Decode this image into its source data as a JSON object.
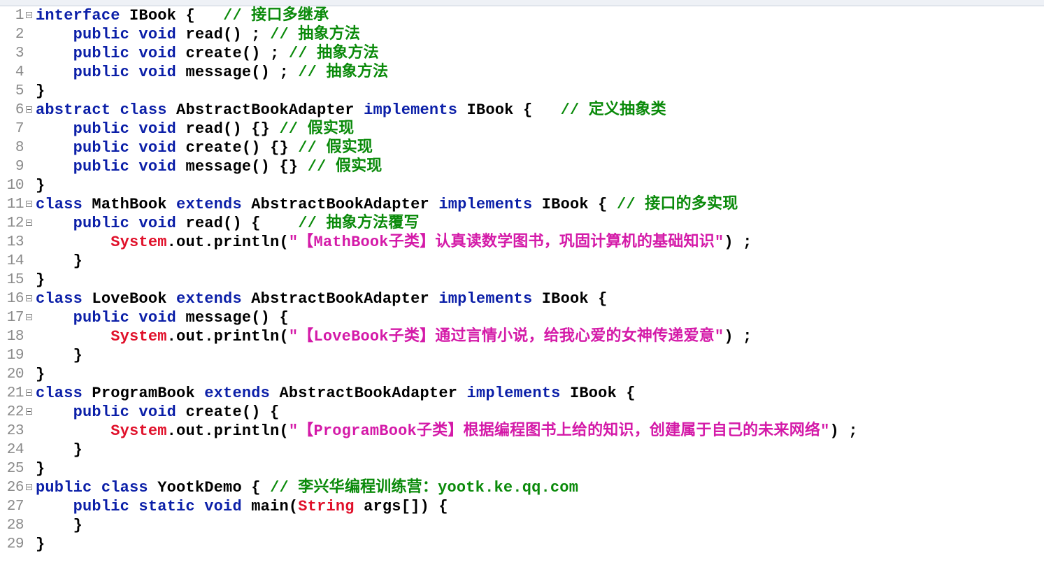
{
  "lines": [
    {
      "num": "1",
      "fold": true,
      "segs": [
        [
          "kw",
          "interface"
        ],
        [
          "pl",
          " IBook {   "
        ],
        [
          "cm",
          "// 接口多继承"
        ]
      ]
    },
    {
      "num": "2",
      "fold": false,
      "segs": [
        [
          "pl",
          "    "
        ],
        [
          "kw",
          "public void"
        ],
        [
          "pl",
          " read() ; "
        ],
        [
          "cm",
          "// 抽象方法"
        ]
      ]
    },
    {
      "num": "3",
      "fold": false,
      "segs": [
        [
          "pl",
          "    "
        ],
        [
          "kw",
          "public void"
        ],
        [
          "pl",
          " create() ; "
        ],
        [
          "cm",
          "// 抽象方法"
        ]
      ]
    },
    {
      "num": "4",
      "fold": false,
      "segs": [
        [
          "pl",
          "    "
        ],
        [
          "kw",
          "public void"
        ],
        [
          "pl",
          " message() ; "
        ],
        [
          "cm",
          "// 抽象方法"
        ]
      ]
    },
    {
      "num": "5",
      "fold": false,
      "segs": [
        [
          "pl",
          "}"
        ]
      ]
    },
    {
      "num": "6",
      "fold": true,
      "segs": [
        [
          "kw",
          "abstract class"
        ],
        [
          "pl",
          " AbstractBookAdapter "
        ],
        [
          "kw",
          "implements"
        ],
        [
          "pl",
          " IBook {   "
        ],
        [
          "cm",
          "// 定义抽象类"
        ]
      ]
    },
    {
      "num": "7",
      "fold": false,
      "segs": [
        [
          "pl",
          "    "
        ],
        [
          "kw",
          "public void"
        ],
        [
          "pl",
          " read() {} "
        ],
        [
          "cm",
          "// 假实现"
        ]
      ]
    },
    {
      "num": "8",
      "fold": false,
      "segs": [
        [
          "pl",
          "    "
        ],
        [
          "kw",
          "public void"
        ],
        [
          "pl",
          " create() {} "
        ],
        [
          "cm",
          "// 假实现"
        ]
      ]
    },
    {
      "num": "9",
      "fold": false,
      "segs": [
        [
          "pl",
          "    "
        ],
        [
          "kw",
          "public void"
        ],
        [
          "pl",
          " message() {} "
        ],
        [
          "cm",
          "// 假实现"
        ]
      ]
    },
    {
      "num": "10",
      "fold": false,
      "segs": [
        [
          "pl",
          "}"
        ]
      ]
    },
    {
      "num": "11",
      "fold": true,
      "segs": [
        [
          "kw",
          "class"
        ],
        [
          "pl",
          " MathBook "
        ],
        [
          "kw",
          "extends"
        ],
        [
          "pl",
          " AbstractBookAdapter "
        ],
        [
          "kw",
          "implements"
        ],
        [
          "pl",
          " IBook { "
        ],
        [
          "cm",
          "// 接口的多实现"
        ]
      ]
    },
    {
      "num": "12",
      "fold": true,
      "segs": [
        [
          "pl",
          "    "
        ],
        [
          "kw",
          "public void"
        ],
        [
          "pl",
          " read() {    "
        ],
        [
          "cm",
          "// 抽象方法覆写"
        ]
      ]
    },
    {
      "num": "13",
      "fold": false,
      "segs": [
        [
          "pl",
          "        "
        ],
        [
          "cls",
          "System"
        ],
        [
          "pl",
          ".out.println("
        ],
        [
          "str",
          "\"【MathBook子类】认真读数学图书，巩固计算机的基础知识\""
        ],
        [
          "pl",
          ") ;"
        ]
      ]
    },
    {
      "num": "14",
      "fold": false,
      "segs": [
        [
          "pl",
          "    }"
        ]
      ]
    },
    {
      "num": "15",
      "fold": false,
      "segs": [
        [
          "pl",
          "}"
        ]
      ]
    },
    {
      "num": "16",
      "fold": true,
      "segs": [
        [
          "kw",
          "class"
        ],
        [
          "pl",
          " LoveBook "
        ],
        [
          "kw",
          "extends"
        ],
        [
          "pl",
          " AbstractBookAdapter "
        ],
        [
          "kw",
          "implements"
        ],
        [
          "pl",
          " IBook {"
        ]
      ]
    },
    {
      "num": "17",
      "fold": true,
      "segs": [
        [
          "pl",
          "    "
        ],
        [
          "kw",
          "public void"
        ],
        [
          "pl",
          " message() {"
        ]
      ]
    },
    {
      "num": "18",
      "fold": false,
      "segs": [
        [
          "pl",
          "        "
        ],
        [
          "cls",
          "System"
        ],
        [
          "pl",
          ".out.println("
        ],
        [
          "str",
          "\"【LoveBook子类】通过言情小说，给我心爱的女神传递爱意\""
        ],
        [
          "pl",
          ") ;"
        ]
      ]
    },
    {
      "num": "19",
      "fold": false,
      "segs": [
        [
          "pl",
          "    }"
        ]
      ]
    },
    {
      "num": "20",
      "fold": false,
      "segs": [
        [
          "pl",
          "}"
        ]
      ]
    },
    {
      "num": "21",
      "fold": true,
      "segs": [
        [
          "kw",
          "class"
        ],
        [
          "pl",
          " ProgramBook "
        ],
        [
          "kw",
          "extends"
        ],
        [
          "pl",
          " AbstractBookAdapter "
        ],
        [
          "kw",
          "implements"
        ],
        [
          "pl",
          " IBook {"
        ]
      ]
    },
    {
      "num": "22",
      "fold": true,
      "segs": [
        [
          "pl",
          "    "
        ],
        [
          "kw",
          "public void"
        ],
        [
          "pl",
          " create() {"
        ]
      ]
    },
    {
      "num": "23",
      "fold": false,
      "segs": [
        [
          "pl",
          "        "
        ],
        [
          "cls",
          "System"
        ],
        [
          "pl",
          ".out.println("
        ],
        [
          "str",
          "\"【ProgramBook子类】根据编程图书上给的知识，创建属于自己的未来网络\""
        ],
        [
          "pl",
          ") ;"
        ]
      ]
    },
    {
      "num": "24",
      "fold": false,
      "segs": [
        [
          "pl",
          "    }"
        ]
      ]
    },
    {
      "num": "25",
      "fold": false,
      "segs": [
        [
          "pl",
          "}"
        ]
      ]
    },
    {
      "num": "26",
      "fold": true,
      "segs": [
        [
          "kw",
          "public class"
        ],
        [
          "pl",
          " YootkDemo { "
        ],
        [
          "cm",
          "// 李兴华编程训练营：yootk.ke.qq.com"
        ]
      ]
    },
    {
      "num": "27",
      "fold": false,
      "segs": [
        [
          "pl",
          "    "
        ],
        [
          "kw",
          "public static void"
        ],
        [
          "pl",
          " main("
        ],
        [
          "cls",
          "String"
        ],
        [
          "pl",
          " args[]) {"
        ]
      ]
    },
    {
      "num": "28",
      "fold": false,
      "segs": [
        [
          "pl",
          "    }"
        ]
      ]
    },
    {
      "num": "29",
      "fold": false,
      "segs": [
        [
          "pl",
          "}"
        ]
      ]
    }
  ]
}
